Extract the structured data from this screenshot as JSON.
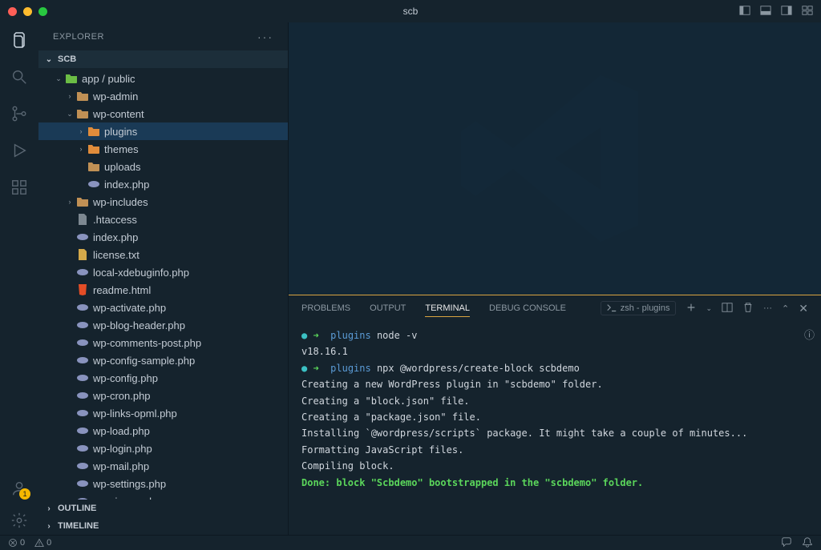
{
  "window_title": "scb",
  "explorer": {
    "title": "EXPLORER",
    "project": "SCB",
    "outline": "OUTLINE",
    "timeline": "TIMELINE"
  },
  "tree": [
    {
      "depth": 0,
      "twisty": "v",
      "icon": "folder-green",
      "label": "app / public"
    },
    {
      "depth": 1,
      "twisty": ">",
      "icon": "folder",
      "label": "wp-admin"
    },
    {
      "depth": 1,
      "twisty": "v",
      "icon": "folder",
      "label": "wp-content"
    },
    {
      "depth": 2,
      "twisty": ">",
      "icon": "folder-orange",
      "label": "plugins",
      "selected": true
    },
    {
      "depth": 2,
      "twisty": ">",
      "icon": "folder-orange",
      "label": "themes"
    },
    {
      "depth": 2,
      "twisty": "",
      "icon": "folder",
      "label": "uploads"
    },
    {
      "depth": 2,
      "twisty": "",
      "icon": "php",
      "label": "index.php"
    },
    {
      "depth": 1,
      "twisty": ">",
      "icon": "folder",
      "label": "wp-includes"
    },
    {
      "depth": 1,
      "twisty": "",
      "icon": "file",
      "label": ".htaccess"
    },
    {
      "depth": 1,
      "twisty": "",
      "icon": "php",
      "label": "index.php"
    },
    {
      "depth": 1,
      "twisty": "",
      "icon": "cert",
      "label": "license.txt"
    },
    {
      "depth": 1,
      "twisty": "",
      "icon": "php",
      "label": "local-xdebuginfo.php"
    },
    {
      "depth": 1,
      "twisty": "",
      "icon": "html",
      "label": "readme.html"
    },
    {
      "depth": 1,
      "twisty": "",
      "icon": "php",
      "label": "wp-activate.php"
    },
    {
      "depth": 1,
      "twisty": "",
      "icon": "php",
      "label": "wp-blog-header.php"
    },
    {
      "depth": 1,
      "twisty": "",
      "icon": "php",
      "label": "wp-comments-post.php"
    },
    {
      "depth": 1,
      "twisty": "",
      "icon": "php",
      "label": "wp-config-sample.php"
    },
    {
      "depth": 1,
      "twisty": "",
      "icon": "php",
      "label": "wp-config.php"
    },
    {
      "depth": 1,
      "twisty": "",
      "icon": "php",
      "label": "wp-cron.php"
    },
    {
      "depth": 1,
      "twisty": "",
      "icon": "php",
      "label": "wp-links-opml.php"
    },
    {
      "depth": 1,
      "twisty": "",
      "icon": "php",
      "label": "wp-load.php"
    },
    {
      "depth": 1,
      "twisty": "",
      "icon": "php",
      "label": "wp-login.php"
    },
    {
      "depth": 1,
      "twisty": "",
      "icon": "php",
      "label": "wp-mail.php"
    },
    {
      "depth": 1,
      "twisty": "",
      "icon": "php",
      "label": "wp-settings.php"
    },
    {
      "depth": 1,
      "twisty": "",
      "icon": "php",
      "label": "wp-signup.php"
    }
  ],
  "panel_tabs": {
    "problems": "PROBLEMS",
    "output": "OUTPUT",
    "terminal": "TERMINAL",
    "debug": "DEBUG CONSOLE"
  },
  "terminal_label": "zsh - plugins",
  "terminal_lines": [
    {
      "segments": [
        {
          "c": "cyan",
          "t": "● "
        },
        {
          "c": "green",
          "t": "➜  "
        },
        {
          "c": "blue",
          "t": "plugins "
        },
        {
          "c": "",
          "t": "node -v"
        }
      ]
    },
    {
      "segments": [
        {
          "c": "",
          "t": "v18.16.1"
        }
      ]
    },
    {
      "segments": [
        {
          "c": "cyan",
          "t": "● "
        },
        {
          "c": "green",
          "t": "➜  "
        },
        {
          "c": "blue",
          "t": "plugins "
        },
        {
          "c": "",
          "t": "npx @wordpress/create-block scbdemo"
        }
      ]
    },
    {
      "segments": [
        {
          "c": "",
          "t": ""
        }
      ]
    },
    {
      "segments": [
        {
          "c": "",
          "t": "Creating a new WordPress plugin in \"scbdemo\" folder."
        }
      ]
    },
    {
      "segments": [
        {
          "c": "",
          "t": ""
        }
      ]
    },
    {
      "segments": [
        {
          "c": "",
          "t": "Creating a \"block.json\" file."
        }
      ]
    },
    {
      "segments": [
        {
          "c": "",
          "t": ""
        }
      ]
    },
    {
      "segments": [
        {
          "c": "",
          "t": "Creating a \"package.json\" file."
        }
      ]
    },
    {
      "segments": [
        {
          "c": "",
          "t": ""
        }
      ]
    },
    {
      "segments": [
        {
          "c": "",
          "t": "Installing `@wordpress/scripts` package. It might take a couple of minutes..."
        }
      ]
    },
    {
      "segments": [
        {
          "c": "",
          "t": ""
        }
      ]
    },
    {
      "segments": [
        {
          "c": "",
          "t": "Formatting JavaScript files."
        }
      ]
    },
    {
      "segments": [
        {
          "c": "",
          "t": ""
        }
      ]
    },
    {
      "segments": [
        {
          "c": "",
          "t": "Compiling block."
        }
      ]
    },
    {
      "segments": [
        {
          "c": "",
          "t": ""
        }
      ]
    },
    {
      "segments": [
        {
          "c": "bgreen",
          "t": "Done: block \"Scbdemo\" bootstrapped in the \"scbdemo\" folder."
        }
      ]
    }
  ],
  "status": {
    "errors": "0",
    "warnings": "0"
  },
  "account_badge": "1"
}
